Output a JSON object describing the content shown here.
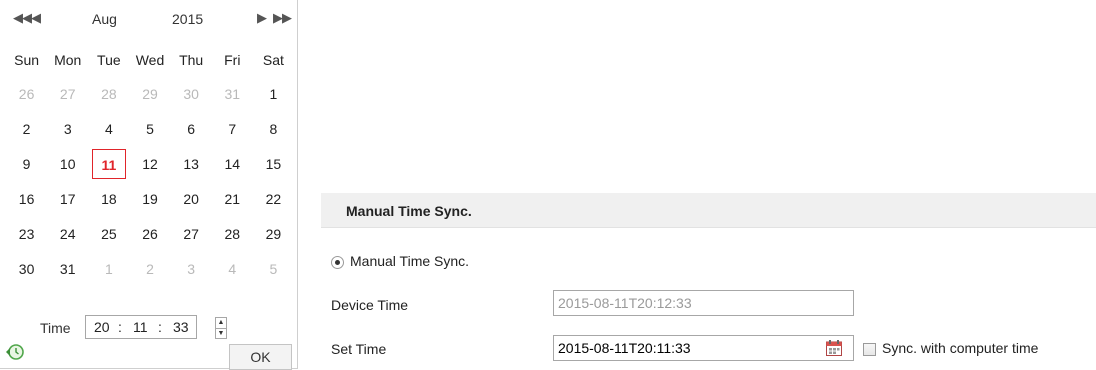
{
  "calendar": {
    "nav": {
      "prev_year": "◀◀",
      "prev_month": "◀",
      "next_month": "▶",
      "next_year": "▶▶"
    },
    "month": "Aug",
    "year": "2015",
    "weekdays": [
      "Sun",
      "Mon",
      "Tue",
      "Wed",
      "Thu",
      "Fri",
      "Sat"
    ],
    "weeks": [
      [
        "26",
        "27",
        "28",
        "29",
        "30",
        "31",
        "1"
      ],
      [
        "2",
        "3",
        "4",
        "5",
        "6",
        "7",
        "8"
      ],
      [
        "9",
        "10",
        "11",
        "12",
        "13",
        "14",
        "15"
      ],
      [
        "16",
        "17",
        "18",
        "19",
        "20",
        "21",
        "22"
      ],
      [
        "23",
        "24",
        "25",
        "26",
        "27",
        "28",
        "29"
      ],
      [
        "30",
        "31",
        "1",
        "2",
        "3",
        "4",
        "5"
      ]
    ],
    "selected_day": "11",
    "time_label": "Time",
    "time": {
      "hour": "20",
      "minute": "11",
      "second": "33",
      "sep": ":"
    },
    "ok_label": "OK",
    "today_icon": "clock-refresh-icon"
  },
  "panel": {
    "title": "Manual Time Sync.",
    "radio_label": "Manual Time Sync.",
    "device_time_label": "Device Time",
    "device_time_value": "2015-08-11T20:12:33",
    "set_time_label": "Set Time",
    "set_time_value": "2015-08-11T20:11:33",
    "sync_label": "Sync. with computer time",
    "calendar_icon": "calendar-icon"
  },
  "colors": {
    "selected": "#e0242a",
    "header_bg": "#f0f0f0",
    "muted": "#b9b9b9"
  }
}
